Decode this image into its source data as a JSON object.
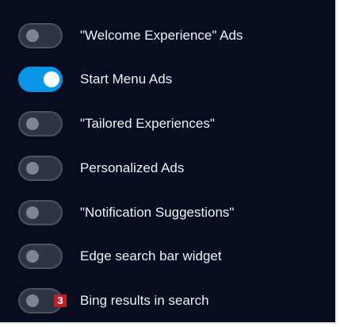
{
  "settings": [
    {
      "label": "\"Welcome Experience\" Ads",
      "enabled": false
    },
    {
      "label": "Start Menu Ads",
      "enabled": true
    },
    {
      "label": "\"Tailored Experiences\"",
      "enabled": false
    },
    {
      "label": "Personalized Ads",
      "enabled": false
    },
    {
      "label": "\"Notification Suggestions\"",
      "enabled": false
    },
    {
      "label": "Edge search bar widget",
      "enabled": false
    },
    {
      "label": "Bing results in search",
      "enabled": false
    }
  ],
  "marker": {
    "text": "3"
  },
  "colors": {
    "background": "#070d1f",
    "toggle_on": "#0a95e8",
    "toggle_off": "#2d3442",
    "marker": "#c01d2a"
  }
}
